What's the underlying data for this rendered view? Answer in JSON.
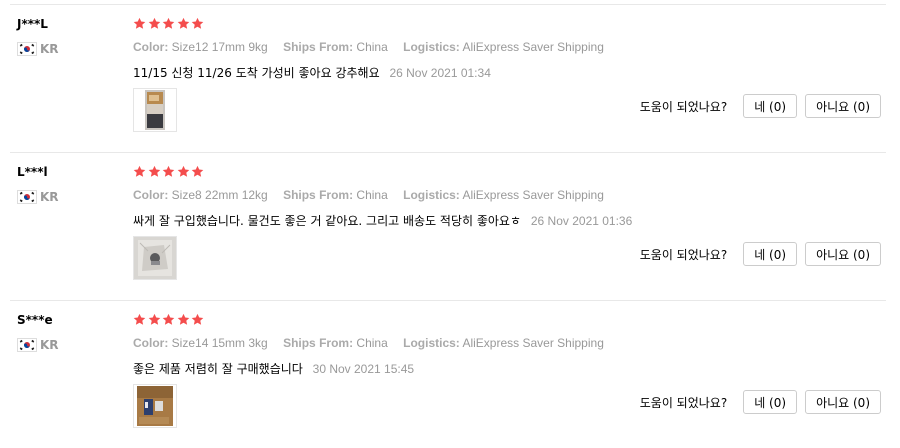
{
  "star_color": "#f44d4d",
  "helpful_question": "도움이 되었나요?",
  "reviews": [
    {
      "user": "J***L",
      "country": "KR",
      "flag_icon": "south-korea-flag-icon",
      "rating": 5,
      "color_key": "Color:",
      "color_value": "Size12 17mm 9kg",
      "ships_key": "Ships From:",
      "ships_value": "China",
      "logistics_key": "Logistics:",
      "logistics_value": "AliExpress Saver Shipping",
      "text": "11/15 신청 11/26 도착 가성비 좋아요 강추해요",
      "date": "26 Nov 2021 01:34",
      "yes_label": "네 (0)",
      "no_label": "아니요 (0)"
    },
    {
      "user": "L***l",
      "country": "KR",
      "flag_icon": "south-korea-flag-icon",
      "rating": 5,
      "color_key": "Color:",
      "color_value": "Size8 22mm 12kg",
      "ships_key": "Ships From:",
      "ships_value": "China",
      "logistics_key": "Logistics:",
      "logistics_value": "AliExpress Saver Shipping",
      "text": "싸게 잘 구입했습니다. 물건도 좋은 거 같아요. 그리고 배송도 적당히 좋아요ㅎ",
      "date": "26 Nov 2021 01:36",
      "yes_label": "네 (0)",
      "no_label": "아니요 (0)"
    },
    {
      "user": "S***e",
      "country": "KR",
      "flag_icon": "south-korea-flag-icon",
      "rating": 5,
      "color_key": "Color:",
      "color_value": "Size14 15mm 3kg",
      "ships_key": "Ships From:",
      "ships_value": "China",
      "logistics_key": "Logistics:",
      "logistics_value": "AliExpress Saver Shipping",
      "text": "좋은 제품 저렴히 잘 구매했습니다",
      "date": "30 Nov 2021 15:45",
      "yes_label": "네 (0)",
      "no_label": "아니요 (0)"
    }
  ]
}
